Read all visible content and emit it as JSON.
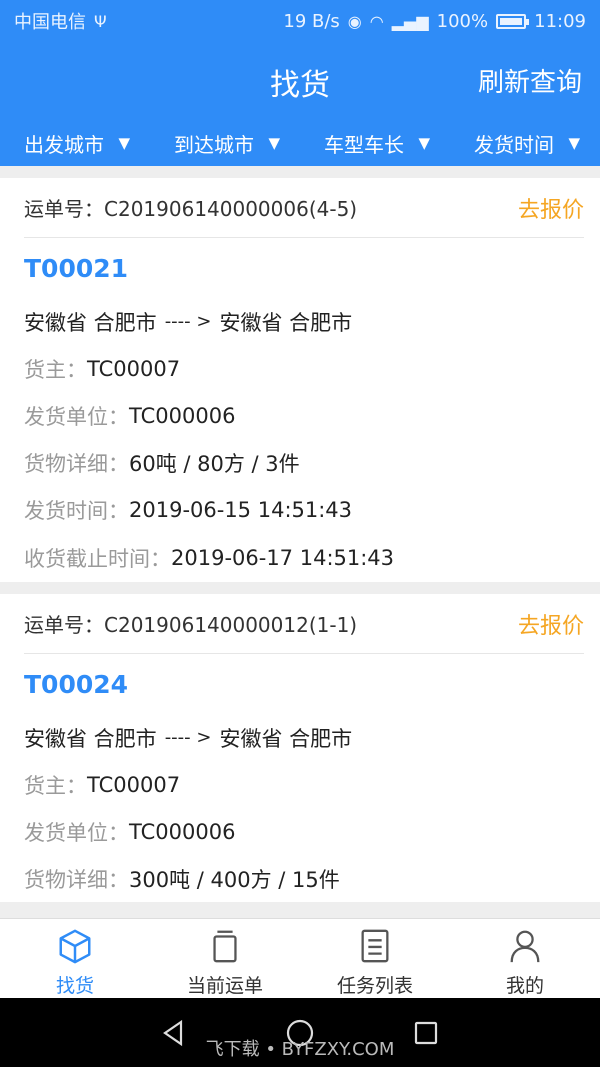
{
  "status": {
    "carrier": "中国电信",
    "usb_icon": "usb-icon",
    "speed": "19 B/s",
    "battery": "100%",
    "time": "11:09"
  },
  "header": {
    "title": "找货",
    "refresh": "刷新查询"
  },
  "filters": [
    {
      "label": "出发城市"
    },
    {
      "label": "到达城市"
    },
    {
      "label": "车型车长"
    },
    {
      "label": "发货时间"
    }
  ],
  "orders": [
    {
      "waybill_label": "运单号：",
      "waybill": "C201906140000006(4-5)",
      "quote": "去报价",
      "code": "T00021",
      "from": "安徽省 合肥市",
      "arrow": "---- >",
      "to": "安徽省 合肥市",
      "owner_label": "货主：",
      "owner": "TC00007",
      "shipper_label": "发货单位：",
      "shipper": "TC000006",
      "detail_label": "货物详细：",
      "detail": "60吨 / 80方 / 3件",
      "ship_time_label": "发货时间：",
      "ship_time": "2019-06-15 14:51:43",
      "deadline_label": "收货截止时间：",
      "deadline": "2019-06-17 14:51:43"
    },
    {
      "waybill_label": "运单号：",
      "waybill": "C201906140000012(1-1)",
      "quote": "去报价",
      "code": "T00024",
      "from": "安徽省 合肥市",
      "arrow": "---- >",
      "to": "安徽省 合肥市",
      "owner_label": "货主：",
      "owner": "TC00007",
      "shipper_label": "发货单位：",
      "shipper": "TC000006",
      "detail_label": "货物详细：",
      "detail": "300吨 / 400方 / 15件"
    }
  ],
  "tabs": [
    {
      "label": "找货",
      "icon": "cube-icon",
      "active": true
    },
    {
      "label": "当前运单",
      "icon": "clipboard-icon",
      "active": false
    },
    {
      "label": "任务列表",
      "icon": "list-icon",
      "active": false
    },
    {
      "label": "我的",
      "icon": "user-icon",
      "active": false
    }
  ],
  "watermark": "飞下载 • BYFZXY.COM",
  "colors": {
    "primary": "#2f8cf7",
    "accent": "#f5a623"
  }
}
